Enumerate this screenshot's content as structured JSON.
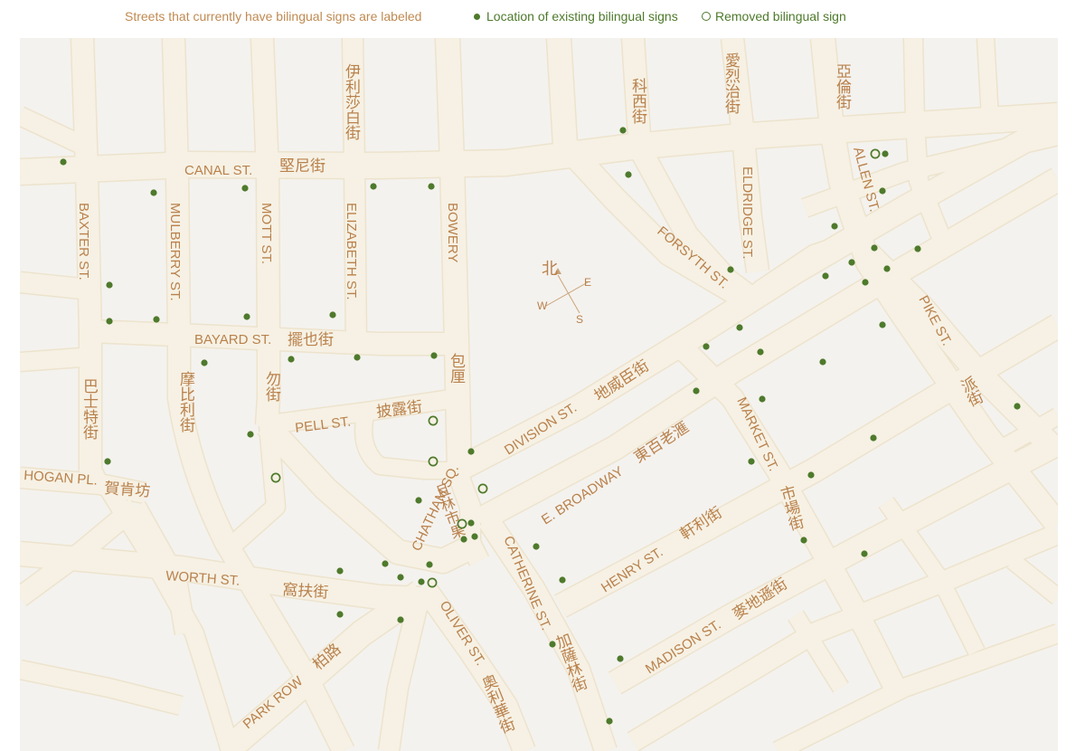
{
  "legend": {
    "note": "Streets that currently have bilingual signs are labeled",
    "existing": "Location of existing bilingual signs",
    "removed": "Removed bilingual sign"
  },
  "colors": {
    "background": "#f4f2ee",
    "street": "#ede3cd",
    "label": "#b9814c",
    "marker": "#4e7a2c"
  },
  "compass": {
    "north": "北",
    "east": "E",
    "west": "W",
    "south": "S"
  },
  "labels": {
    "canal_en": "CANAL ST.",
    "canal_zh": "堅尼街",
    "bayard_en": "BAYARD ST.",
    "bayard_zh": "擺也街",
    "pell_en": "PELL ST.",
    "pell_zh": "披露街",
    "hogan_en": "HOGAN PL.",
    "hogan_zh": "賀肯坊",
    "worth_en": "WORTH ST.",
    "worth_zh": "窩扶街",
    "parkrow_en": "PARK ROW",
    "parkrow_zh": "柏路",
    "baxter_en": "BAXTER ST.",
    "baxter_zh": "巴士特街",
    "mulberry_en": "MULBERRY ST.",
    "mulberry_zh": "摩比利街",
    "mott_en": "MOTT ST.",
    "mott_zh": "勿街",
    "elizabeth_en": "ELIZABETH ST.",
    "elizabeth_zh": "伊利莎白街",
    "bowery_en": "BOWERY",
    "bowery_zh": "包厘",
    "division_en": "DIVISION ST.",
    "division_zh": "地威臣街",
    "ebroadway_en": "E. BROADWAY",
    "ebroadway_zh": "東百老滙",
    "chatham_en": "CHATHAM SQ.",
    "chatham_zh": "且林市果",
    "catherine_en": "CATHERINE ST.",
    "catherine_zh": "加薩林街",
    "oliver_en": "OLIVER ST.",
    "oliver_zh": "奧利華街",
    "henry_en": "HENRY ST.",
    "henry_zh": "軒利街",
    "madison_en": "MADISON ST.",
    "madison_zh": "麥地遜街",
    "market_en": "MARKET ST.",
    "market_zh": "市場街",
    "pike_en": "PIKE ST.",
    "pike_zh": "派街",
    "forsyth_en": "FORSYTH ST.",
    "forsyth_zh": "科西街",
    "eldridge_en": "ELDRIDGE ST.",
    "eldridge_zh": "愛烈治街",
    "allen_en": "ALLEN ST.",
    "allen_zh": "亞倫街"
  }
}
